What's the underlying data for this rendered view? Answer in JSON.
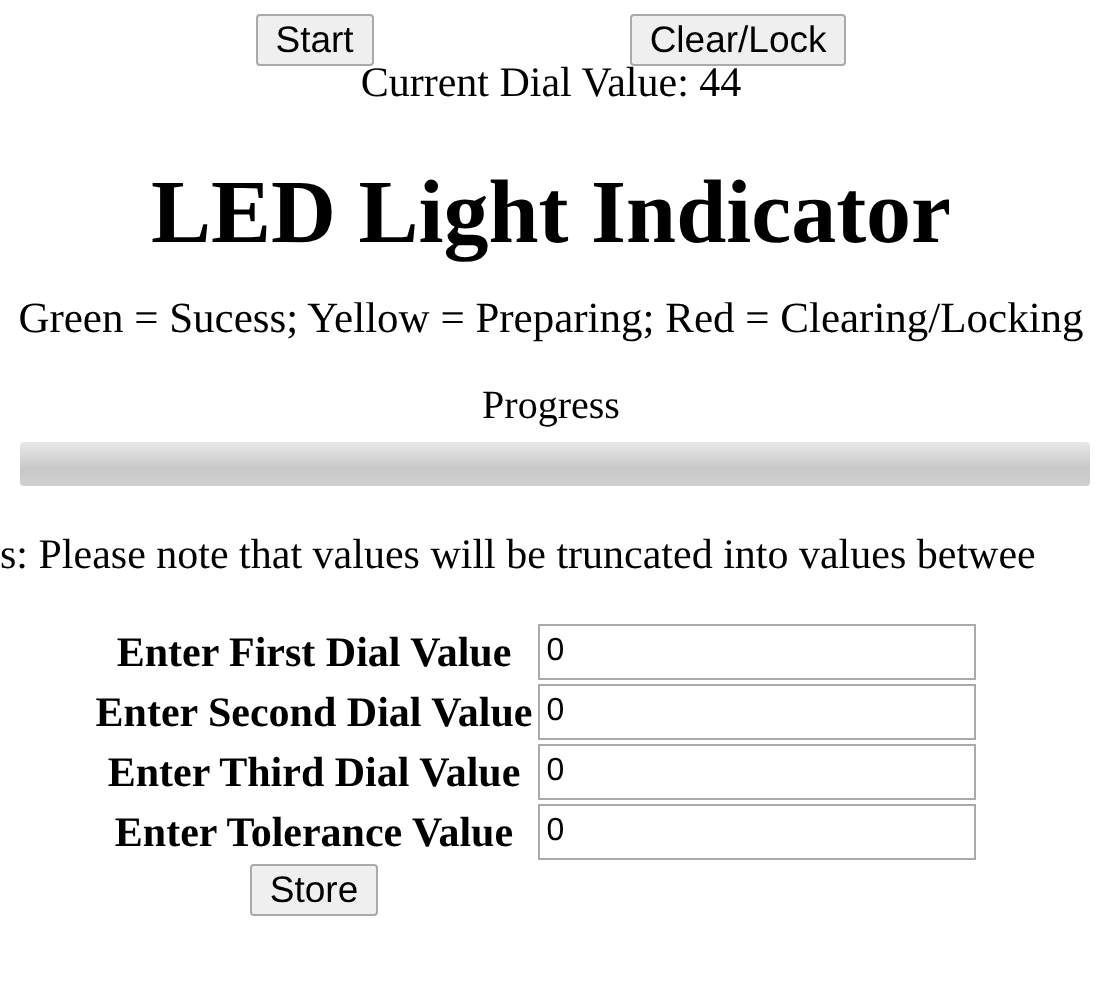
{
  "buttons": [
    {
      "label": "Start"
    },
    {
      "label": "Clear/Lock"
    }
  ],
  "dial_readout": "Current Dial Value: 44",
  "heading": "LED Light Indicator",
  "legend": "Green = Sucess; Yellow = Preparing; Red = Clearing/Locking",
  "progress": {
    "label": "Progress",
    "level": 0
  },
  "note": "s: Please note that values will be truncated into values betwee",
  "form": {
    "fields": [
      {
        "label": "Enter First Dial Value",
        "value": "0"
      },
      {
        "label": "Enter Second Dial Value",
        "value": "0"
      },
      {
        "label": "Enter Third Dial Value",
        "value": "0"
      },
      {
        "label": "Enter Tolerance Value",
        "value": "0"
      }
    ],
    "submit": "Store"
  }
}
